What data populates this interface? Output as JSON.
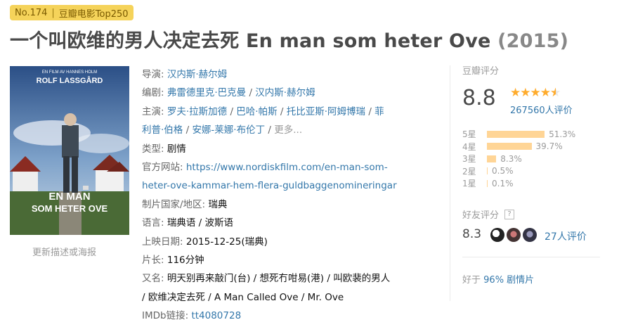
{
  "badge": {
    "rank": "No.174",
    "list": "豆瓣电影Top250"
  },
  "title": {
    "name": "一个叫欧维的男人决定去死 En man som heter Ove",
    "year": "(2015)"
  },
  "poster": {
    "tagline": "EN FILM AV HANNES HOLM",
    "star": "ROLF LASSGÅRD",
    "title_lines": [
      "EN MAN",
      "SOM HETER OVE"
    ]
  },
  "update_link": "更新描述或海报",
  "info": {
    "director_label": "导演:",
    "director": "汉内斯·赫尔姆",
    "writer_label": "编剧:",
    "writers": [
      "弗雷德里克·巴克曼",
      "汉内斯·赫尔姆"
    ],
    "cast_label": "主演:",
    "cast_line1": [
      "罗夫·拉斯加德",
      "巴哈·帕斯",
      "托比亚斯·阿姆博瑞",
      "菲"
    ],
    "cast_line2": [
      "利普·伯格",
      "安娜-莱娜·布伦丁"
    ],
    "cast_more": "更多...",
    "genre_label": "类型:",
    "genre": "剧情",
    "site_label": "官方网站:",
    "site_line1": "https://www.nordiskfilm.com/en-man-som-",
    "site_line2": "heter-ove-kammar-hem-flera-guldbaggenomineringar",
    "country_label": "制片国家/地区:",
    "country": "瑞典",
    "lang_label": "语言:",
    "lang": "瑞典语 / 波斯语",
    "release_label": "上映日期:",
    "release": "2015-12-25(瑞典)",
    "runtime_label": "片长:",
    "runtime": "116分钟",
    "aka_label": "又名:",
    "aka_line1": "明天别再来敲门(台) / 想死冇咁易(港) / 叫欧裴的男人",
    "aka_line2": "/ 欧维决定去死 / A Man Called Ove / Mr. Ove",
    "imdb_label": "IMDb链接:",
    "imdb": "tt4080728"
  },
  "rating": {
    "section_title": "豆瓣评分",
    "score": "8.8",
    "stars": 4.5,
    "votes": "267560人评价",
    "distribution": [
      {
        "label": "5星",
        "pct": "51.3%",
        "value": 51.3
      },
      {
        "label": "4星",
        "pct": "39.7%",
        "value": 39.7
      },
      {
        "label": "3星",
        "pct": "8.3%",
        "value": 8.3
      },
      {
        "label": "2星",
        "pct": "0.5%",
        "value": 0.5
      },
      {
        "label": "1星",
        "pct": "0.1%",
        "value": 0.1
      }
    ]
  },
  "friends": {
    "title": "好友评分",
    "score": "8.3",
    "votes": "27人评价"
  },
  "better": {
    "prefix": "好于",
    "link": "96% 剧情片"
  },
  "colors": {
    "link": "#3377aa",
    "star": "#ffac2d",
    "bar": "#ffd596",
    "badge": "#f5d35a"
  }
}
